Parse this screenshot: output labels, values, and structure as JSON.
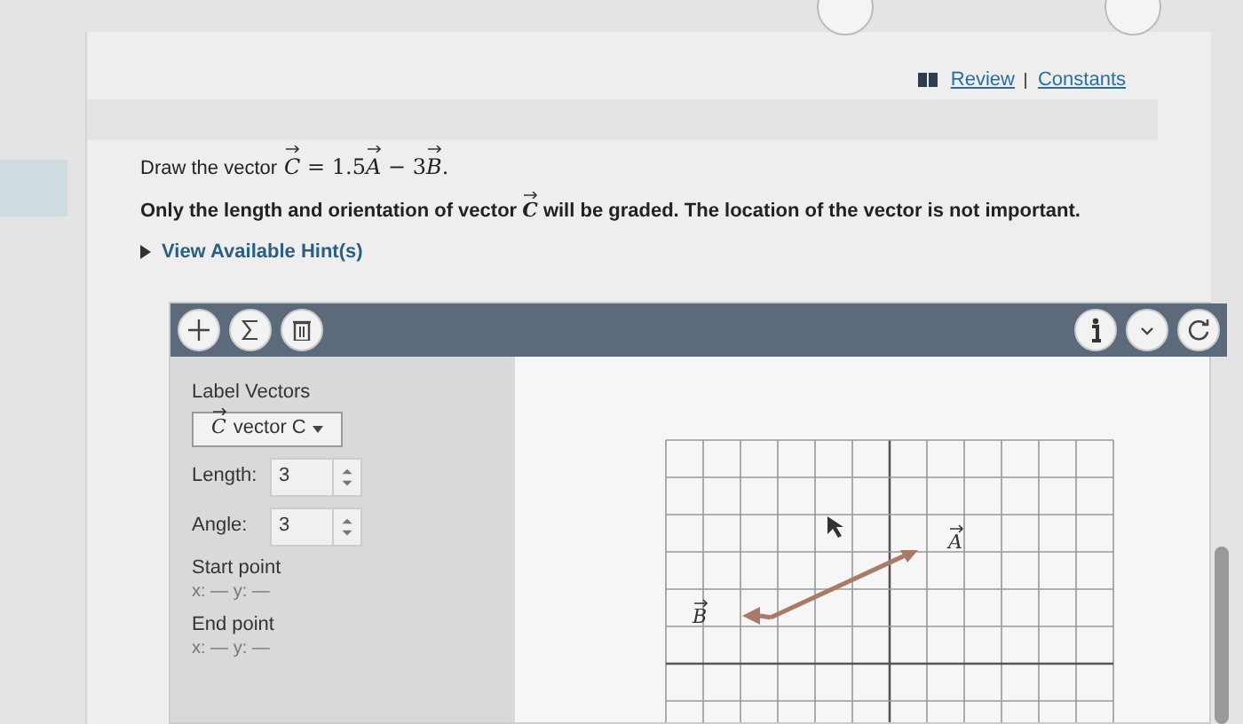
{
  "header_links": [
    "Review",
    "Constants"
  ],
  "problem": {
    "lead": "Draw the vector",
    "equation": [
      {
        "text": "C",
        "vector": true
      },
      {
        "text": " = 1.5",
        "vector": false
      },
      {
        "text": "A",
        "vector": true
      },
      {
        "text": " − 3",
        "vector": false
      },
      {
        "text": "B",
        "vector": true
      },
      {
        "text": ".",
        "vector": false
      }
    ],
    "note": [
      {
        "text": "Only the length and orientation of vector ",
        "vector": false
      },
      {
        "text": "C",
        "vector": true
      },
      {
        "text": " will be graded. The location of the vector is not important.",
        "vector": false
      }
    ],
    "hints": {
      "label": "View Available Hint(s)",
      "expanded": false
    }
  },
  "tool": {
    "label_vectors": {
      "title": "Label Vectors",
      "symbol": "C",
      "value": "vector C"
    },
    "fields": [
      {
        "label": "Length:",
        "value": "3"
      },
      {
        "label": "Angle:",
        "value": "3"
      }
    ],
    "points": [
      {
        "title": "Start point",
        "coords": "x: — y: —"
      },
      {
        "title": "End point",
        "coords": "x: — y: —"
      }
    ],
    "canvas": {
      "vectors": [
        {
          "label": "A"
        },
        {
          "label": "B"
        }
      ]
    }
  }
}
